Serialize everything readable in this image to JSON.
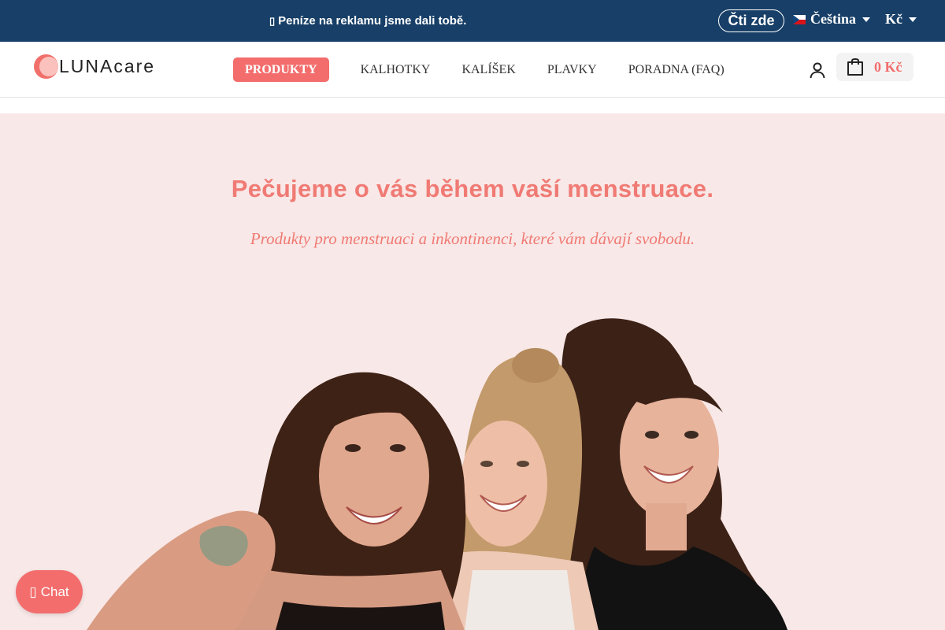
{
  "announcement": {
    "icon": "gift-icon",
    "text": "Peníze na reklamu jsme dali tobě.",
    "button": "Čti zde"
  },
  "locale": {
    "language": "Čeština",
    "flag": "cz-flag-icon",
    "currency": "Kč"
  },
  "header": {
    "logo": "LUNAcare",
    "nav": {
      "active": "PRODUKTY",
      "items": [
        "KALHOTKY",
        "KALÍŠEK",
        "PLAVKY",
        "PORADNA (FAQ)"
      ]
    },
    "account_icon": "user-icon",
    "cart": {
      "icon": "shopping-bag-icon",
      "total": "0 Kč"
    }
  },
  "hero": {
    "title": "Pečujeme o vás během vaší menstruace.",
    "subtitle": "Produkty pro menstruaci a inkontinenci, které vám dávají svobodu.",
    "image": "three-smiling-women-photo"
  },
  "chat": {
    "icon": "chat-icon",
    "label": "Chat"
  },
  "colors": {
    "topbar": "#173f67",
    "accent": "#f36d6d",
    "hero_bg": "#f8e8e7",
    "hero_text": "#f07a74"
  }
}
